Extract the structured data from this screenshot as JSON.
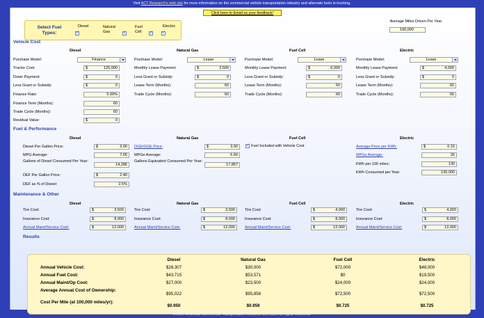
{
  "topbar": {
    "pre": "Visit ",
    "link": "ACT Research's web site",
    "post": " for more information on the commercial vehicle transportation industry and alternate fuels in trucking."
  },
  "feedback_label": "Click here to Email us your feedback!",
  "fuel_types": {
    "title": "Select Fuel Types:",
    "options": [
      {
        "label": "Diesel",
        "checked": true
      },
      {
        "label": "Natural Gas",
        "checked": true
      },
      {
        "label": "Fuel Cell",
        "checked": true
      },
      {
        "label": "Electric",
        "checked": true
      }
    ]
  },
  "avg_miles": {
    "label": "Average Miles Driven Per Year",
    "value": "100,000"
  },
  "sections": {
    "vehicle": "Vehicle Cost",
    "fuel": "Fuel & Performance",
    "maint": "Maintenance & Other",
    "results": "Results"
  },
  "columns": [
    "Diesel",
    "Natural Gas",
    "Fuel Cell",
    "Electric"
  ],
  "vehicle": {
    "diesel": {
      "purchase_model_label": "Purchase Model:",
      "purchase_model": "Finance",
      "tractor_cost_label": "Tractor Cost:",
      "tractor_cost": "125,000",
      "down_payment_label": "Down Payment:",
      "down_payment": "0",
      "grant_label": "Less Grant or Subsidy:",
      "grant": "0",
      "finance_rate_label": "Finance Rate:",
      "finance_rate": "5.00%",
      "finance_term_label": "Finance Term (Months):",
      "finance_term": "60",
      "trade_cycle_label": "Trade Cycle (Months):",
      "trade_cycle": "60",
      "residual_label": "Residual Value:",
      "residual": "0"
    },
    "ng": {
      "purchase_model_label": "Purchase Model:",
      "purchase_model": "Lease",
      "lease_label": "Monthly Lease Payment:",
      "lease": "2,500",
      "grant_label": "Less Grant or Subsidy:",
      "grant": "0",
      "term_label": "Lease Term (Months):",
      "term": "60",
      "cycle_label": "Trade Cycle (Months):",
      "cycle": "60"
    },
    "fc": {
      "purchase_model_label": "Purchase Model:",
      "purchase_model": "Lease",
      "lease_label": "Monthly Lease Payment:",
      "lease": "6,000",
      "grant_label": "Less Grant or Subsidy:",
      "grant": "0",
      "term_label": "Lease Term (Months):",
      "term": "60",
      "cycle_label": "Trade Cycle (Months):",
      "cycle": "60"
    },
    "el": {
      "purchase_model_label": "Purchase Model:",
      "purchase_model": "Lease",
      "lease_label": "Monthly Lease Payment:",
      "lease": "4,000",
      "grant_label": "Less Grant or Subsidy:",
      "grant": "0",
      "term_label": "Lease Term (Months):",
      "term": "60",
      "cycle_label": "Trade Cycle (Months):",
      "cycle": "60"
    }
  },
  "fuel": {
    "diesel": {
      "price_label": "Diesel Per Gallon Price:",
      "price": "3.00",
      "mpg_label": "MPG Average:",
      "mpg": "7.00",
      "gallons_label": "Gallons of Diesel Consumed Per Year:",
      "gallons": "14,286",
      "def_price_label": "DEF Per Gallon Price:",
      "def_price": "2.40",
      "def_pct_label": "DEF as % of Diesel:",
      "def_pct": "2.5%"
    },
    "ng": {
      "price_label": "DGE/GGE Price:",
      "price": "3.00",
      "mpg_label": "MPGe Average:",
      "mpg": "5.60",
      "gallons_label": "Gallons Equivalent Consumed Per Year:",
      "gallons": "17,857"
    },
    "fc": {
      "included_label": "Fuel Included with Vehicle Cost"
    },
    "el": {
      "price_label": "Average Price per KWh:",
      "price": "0.15",
      "mpg_label": "MPGe Average:",
      "mpg": "26",
      "kwh100_label": "KWh per 100 miles:",
      "kwh100": "130",
      "kwhyr_label": "KWh Consumed per Year:",
      "kwhyr": "130,000"
    }
  },
  "maint": {
    "tire_label": "Tire Cost:",
    "ins_label": "Insurance Cost:",
    "am_label": "Annual Maint/Service Cost:",
    "diesel": {
      "tire": "3,500",
      "ins": "8,000",
      "am": "12,000"
    },
    "ng": {
      "tire": "3,500",
      "ins": "8,000",
      "am": "12,000"
    },
    "fc": {
      "tire": "4,000",
      "ins": "8,000",
      "am": "12,000"
    },
    "el": {
      "tire": "4,000",
      "ins": "8,000",
      "am": "12,000"
    }
  },
  "results": {
    "labels": [
      "Annual Vehicle Cost:",
      "Annual Fuel Cost:",
      "Annual Maint/Op Cost:",
      "Average Annual Cost of Ownership:",
      "Cost Per Mile (at 100,000 miles/yr):"
    ],
    "diesel": [
      "$28,307",
      "$43,715",
      "$27,000",
      "$95,022",
      "$0.950"
    ],
    "ng": [
      "$30,000",
      "$53,571",
      "$23,500",
      "$95,858",
      "$0.959"
    ],
    "fc": [
      "$72,000",
      "$0",
      "$24,000",
      "$72,500",
      "$0.725"
    ],
    "el": [
      "$48,000",
      "$19,500",
      "$24,000",
      "$72,500",
      "$0.725"
    ]
  },
  "footer": "© 2017 Americas Commercial Transportation Research Co., LLC. All Rights Reserved."
}
